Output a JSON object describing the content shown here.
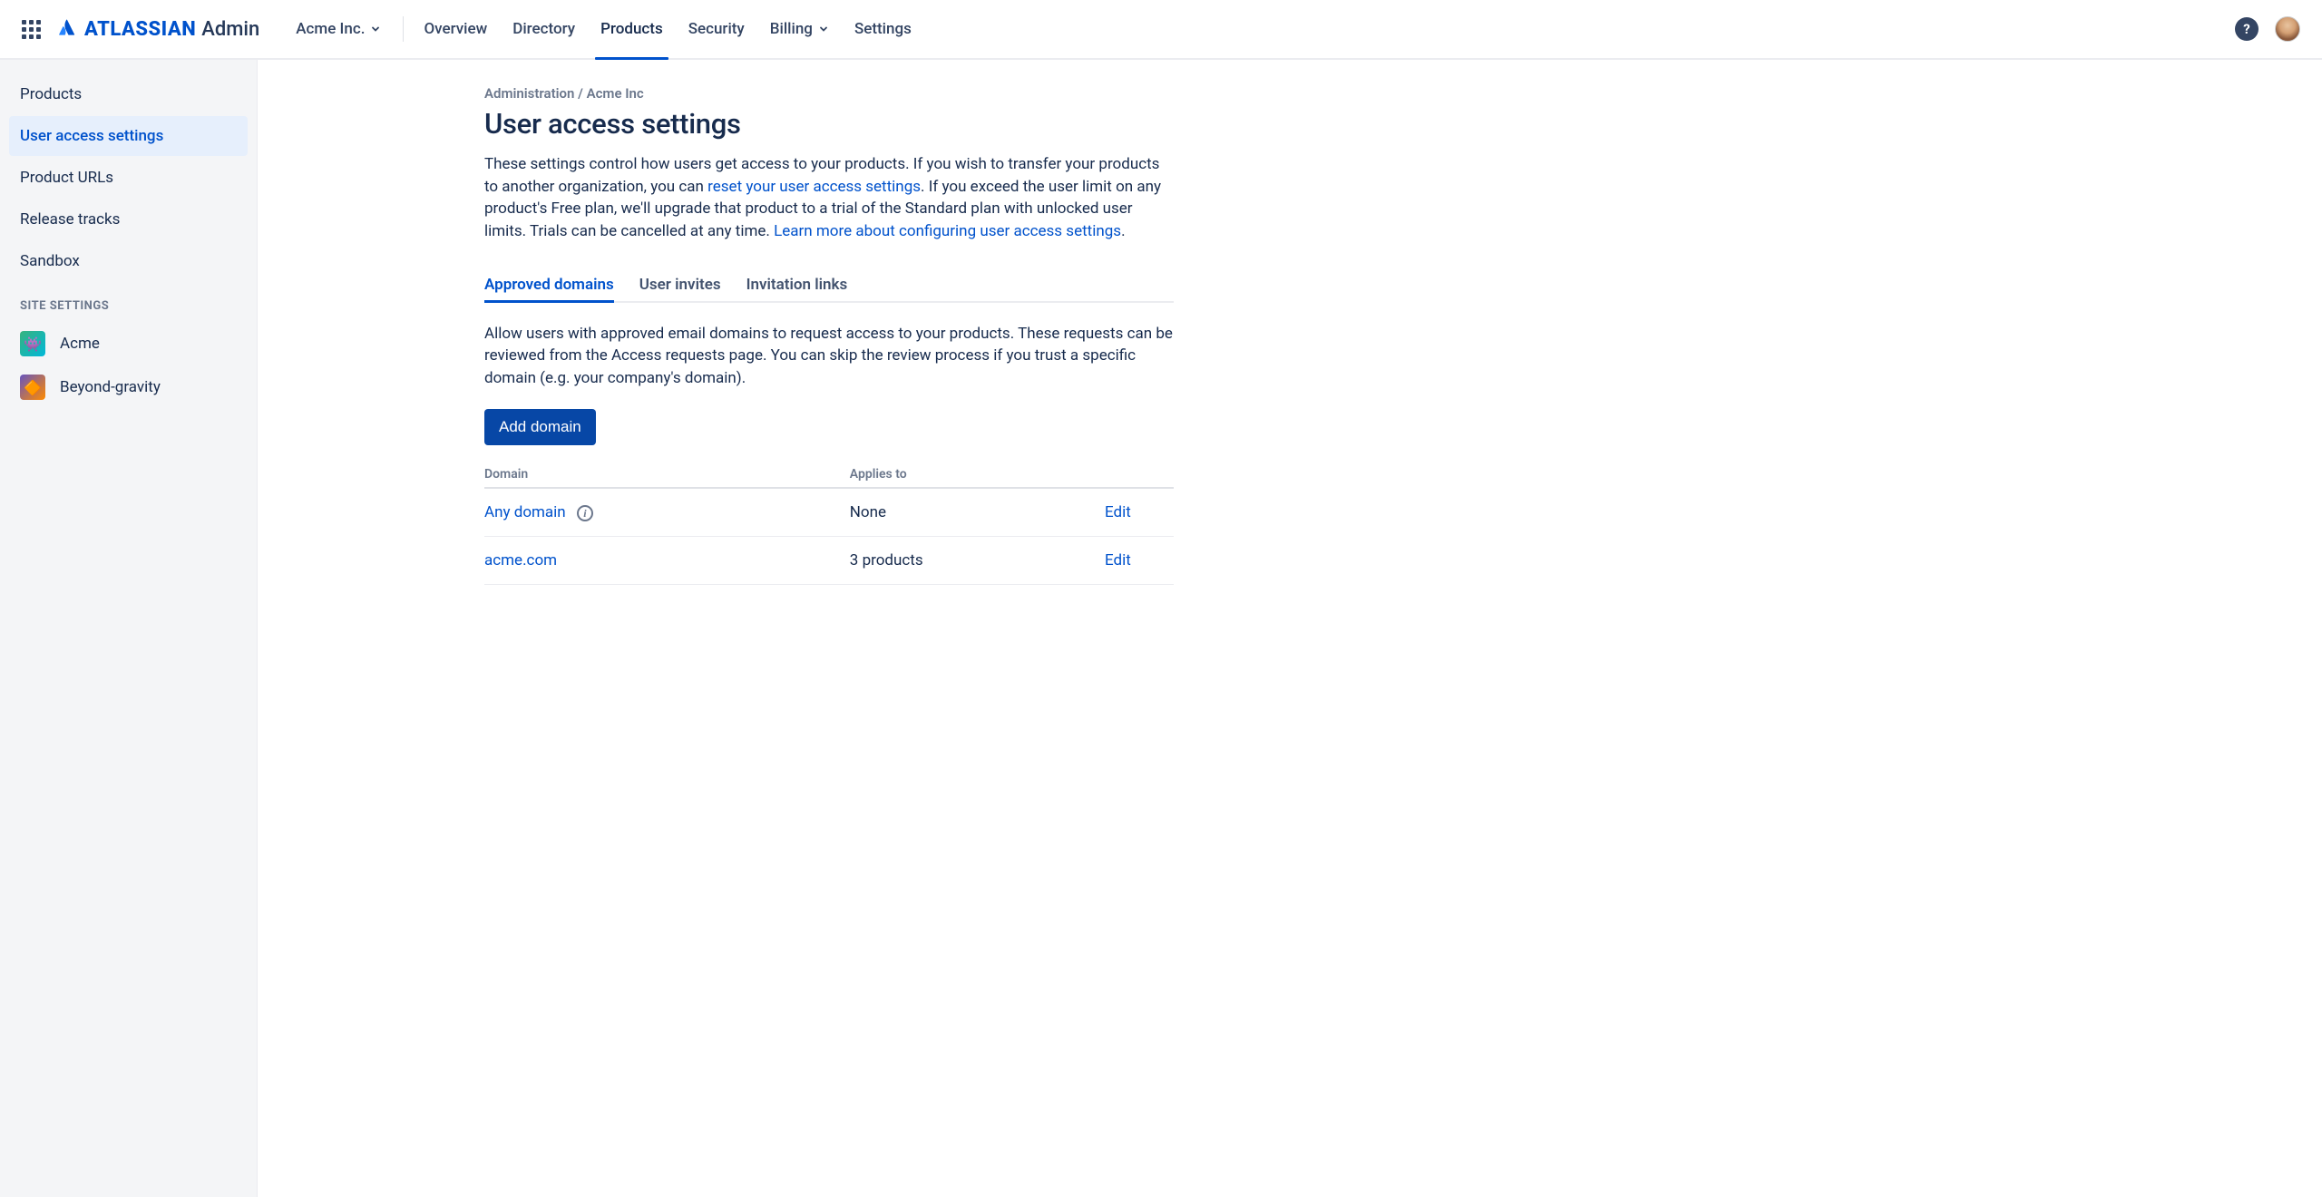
{
  "brand": {
    "name": "ATLASSIAN",
    "suffix": "Admin"
  },
  "org_picker": {
    "label": "Acme Inc."
  },
  "top_nav": {
    "overview": "Overview",
    "directory": "Directory",
    "products": "Products",
    "security": "Security",
    "billing": "Billing",
    "settings": "Settings"
  },
  "sidebar": {
    "items": [
      {
        "label": "Products"
      },
      {
        "label": "User access settings"
      },
      {
        "label": "Product URLs"
      },
      {
        "label": "Release tracks"
      },
      {
        "label": "Sandbox"
      }
    ],
    "section_label": "SITE SETTINGS",
    "sites": [
      {
        "label": "Acme"
      },
      {
        "label": "Beyond-gravity"
      }
    ]
  },
  "breadcrumb": "Administration / Acme Inc",
  "page_title": "User access settings",
  "description": {
    "p1": "These settings control how users get access to your products. If you wish to transfer your products to another organization, you can ",
    "link1": "reset your user access settings",
    "p2": ". If you exceed the user limit on any product's Free plan, we'll upgrade that product to a trial of the Standard plan with unlocked user limits. Trials can be cancelled at any time. ",
    "link2": "Learn more about configuring user access settings",
    "p3": "."
  },
  "tabs": {
    "approved": "Approved domains",
    "invites": "User invites",
    "links": "Invitation links"
  },
  "tab_desc": "Allow users with approved email domains to request access to your products. These requests can be reviewed from the Access requests page. You can skip the review process if you trust a specific domain (e.g. your company's domain).",
  "add_domain_btn": "Add domain",
  "table": {
    "head_domain": "Domain",
    "head_applies": "Applies to",
    "rows": [
      {
        "domain": "Any domain",
        "applies": "None",
        "action": "Edit",
        "info": true
      },
      {
        "domain": "acme.com",
        "applies": "3 products",
        "action": "Edit",
        "info": false
      }
    ]
  }
}
